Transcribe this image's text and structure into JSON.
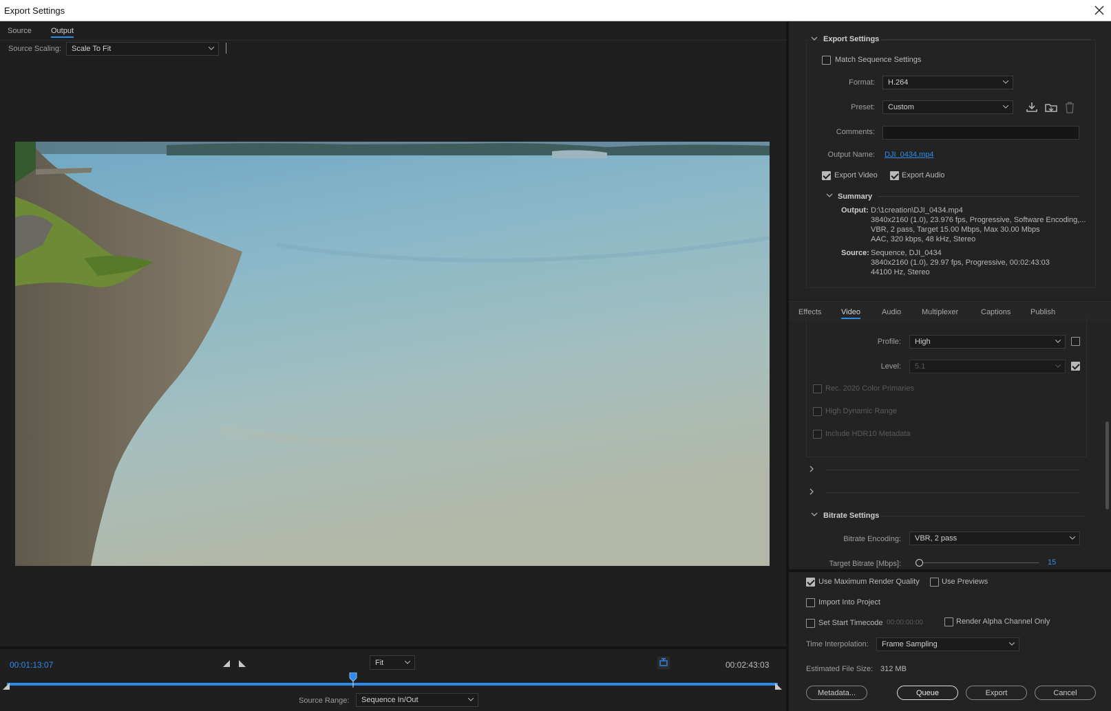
{
  "window": {
    "title": "Export Settings"
  },
  "left": {
    "tabs": [
      {
        "label": "Source",
        "active": false
      },
      {
        "label": "Output",
        "active": true
      }
    ],
    "source_scaling_label": "Source Scaling:",
    "source_scaling_value": "Scale To Fit",
    "current_timecode": "00:01:13:07",
    "fit_value": "Fit",
    "end_timecode": "00:02:43:03",
    "playhead_fraction": 0.449,
    "source_range_label": "Source Range:",
    "source_range_value": "Sequence In/Out"
  },
  "export_settings": {
    "header": "Export Settings",
    "match_sequence_label": "Match Sequence Settings",
    "match_sequence_checked": false,
    "format_label": "Format:",
    "format_value": "H.264",
    "preset_label": "Preset:",
    "preset_value": "Custom",
    "comments_label": "Comments:",
    "comments_value": "",
    "output_name_label": "Output Name:",
    "output_name_value": "DJI_0434.mp4",
    "export_video_label": "Export Video",
    "export_video_checked": true,
    "export_audio_label": "Export Audio",
    "export_audio_checked": true,
    "summary": {
      "header": "Summary",
      "output_label": "Output:",
      "output_lines": [
        "D:\\1creation\\DJI_0434.mp4",
        "3840x2160 (1.0), 23.976 fps, Progressive, Software Encoding,...",
        "VBR, 2 pass, Target 15.00 Mbps, Max 30.00 Mbps",
        "AAC, 320 kbps, 48 kHz, Stereo"
      ],
      "source_label": "Source:",
      "source_lines": [
        "Sequence, DJI_0434",
        "3840x2160 (1.0), 29.97 fps, Progressive, 00:02:43:03",
        "44100 Hz, Stereo"
      ]
    }
  },
  "tabs": [
    {
      "label": "Effects",
      "active": false
    },
    {
      "label": "Video",
      "active": true
    },
    {
      "label": "Audio",
      "active": false
    },
    {
      "label": "Multiplexer",
      "active": false
    },
    {
      "label": "Captions",
      "active": false
    },
    {
      "label": "Publish",
      "active": false
    }
  ],
  "video": {
    "profile_label": "Profile:",
    "profile_value": "High",
    "level_label": "Level:",
    "level_value": "5.1",
    "rec2020_label": "Rec. 2020 Color Primaries",
    "hdr_label": "High Dynamic Range",
    "hdr10_label": "Include HDR10 Metadata",
    "bitrate_header": "Bitrate Settings",
    "bitrate_encoding_label": "Bitrate Encoding:",
    "bitrate_encoding_value": "VBR, 2 pass",
    "target_bitrate_label": "Target Bitrate [Mbps]:",
    "target_bitrate_value": "15"
  },
  "bottom": {
    "max_render_label": "Use Maximum Render Quality",
    "max_render_checked": true,
    "use_previews_label": "Use Previews",
    "use_previews_checked": false,
    "import_label": "Import Into Project",
    "import_checked": false,
    "start_tc_label": "Set Start Timecode",
    "start_tc_value": "00:00:00:00",
    "alpha_label": "Render Alpha Channel Only",
    "time_interp_label": "Time Interpolation:",
    "time_interp_value": "Frame Sampling",
    "est_size_label": "Estimated File Size:",
    "est_size_value": "312 MB",
    "buttons": {
      "metadata": "Metadata...",
      "queue": "Queue",
      "export": "Export",
      "cancel": "Cancel"
    }
  },
  "colors": {
    "accent": "#2d8ceb",
    "panel": "#232323",
    "background": "#1f1f1f"
  }
}
